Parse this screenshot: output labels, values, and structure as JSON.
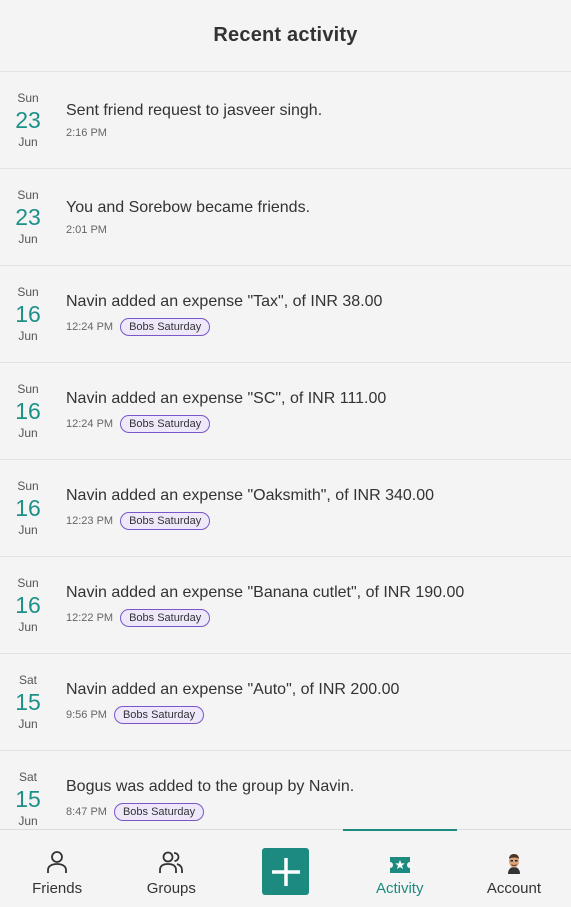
{
  "header": {
    "title": "Recent activity"
  },
  "activities": [
    {
      "dow": "Sun",
      "day": "23",
      "mon": "Jun",
      "text": "Sent friend request to jasveer singh.",
      "time": "2:16 PM",
      "group": ""
    },
    {
      "dow": "Sun",
      "day": "23",
      "mon": "Jun",
      "text": "You and Sorebow became friends.",
      "time": "2:01 PM",
      "group": ""
    },
    {
      "dow": "Sun",
      "day": "16",
      "mon": "Jun",
      "text": "Navin added an expense \"Tax\", of INR 38.00",
      "time": "12:24 PM",
      "group": "Bobs Saturday"
    },
    {
      "dow": "Sun",
      "day": "16",
      "mon": "Jun",
      "text": "Navin added an expense \"SC\", of INR 111.00",
      "time": "12:24 PM",
      "group": "Bobs Saturday"
    },
    {
      "dow": "Sun",
      "day": "16",
      "mon": "Jun",
      "text": "Navin added an expense \"Oaksmith\", of INR 340.00",
      "time": "12:23 PM",
      "group": "Bobs Saturday"
    },
    {
      "dow": "Sun",
      "day": "16",
      "mon": "Jun",
      "text": "Navin added an expense \"Banana cutlet\", of INR 190.00",
      "time": "12:22 PM",
      "group": "Bobs Saturday"
    },
    {
      "dow": "Sat",
      "day": "15",
      "mon": "Jun",
      "text": "Navin added an expense \"Auto\", of INR 200.00",
      "time": "9:56 PM",
      "group": "Bobs Saturday"
    },
    {
      "dow": "Sat",
      "day": "15",
      "mon": "Jun",
      "text": "Bogus was added to the group by Navin.",
      "time": "8:47 PM",
      "group": "Bobs Saturday"
    }
  ],
  "nav": {
    "friends": "Friends",
    "groups": "Groups",
    "activity": "Activity",
    "account": "Account"
  },
  "colors": {
    "accent": "#1d8a80",
    "badge_border": "#7a56c9",
    "badge_bg": "#efe8fb"
  }
}
